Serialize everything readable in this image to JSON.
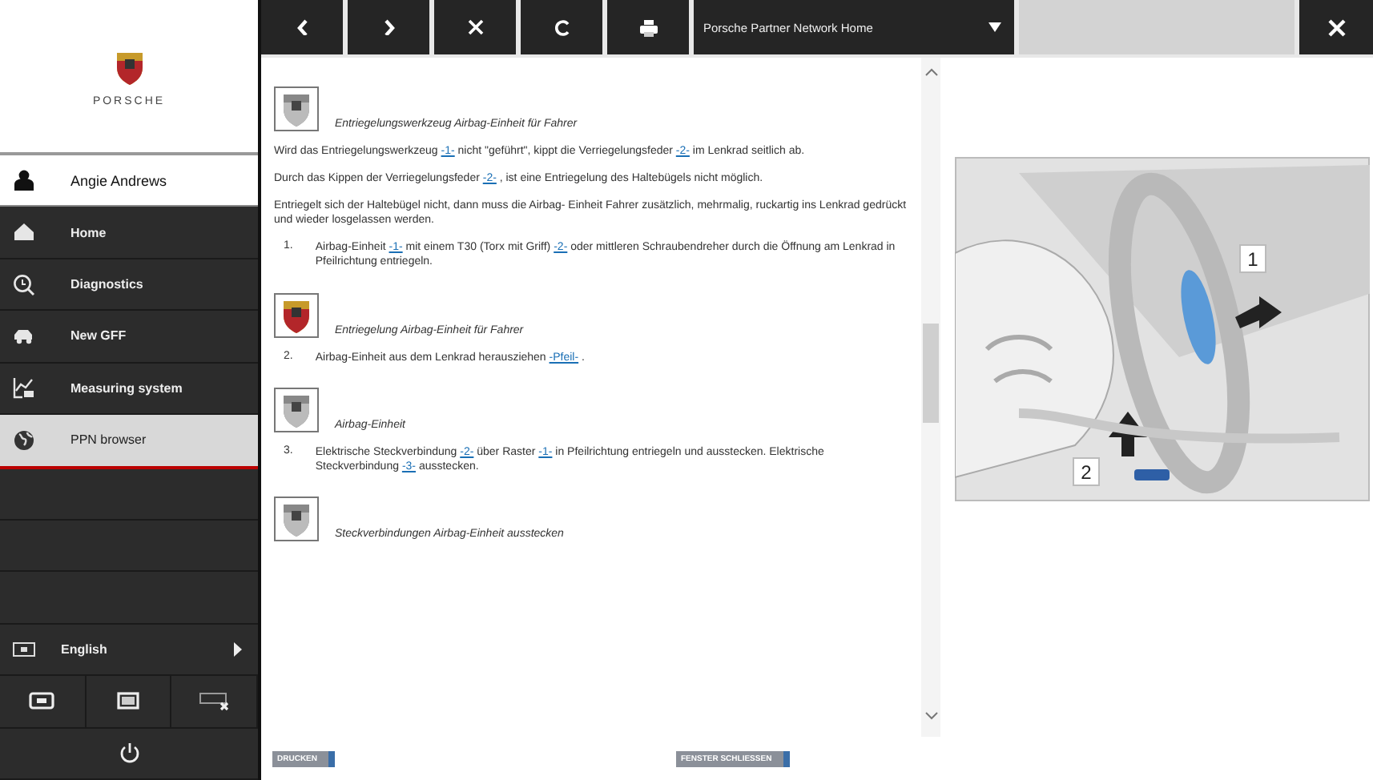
{
  "sidebar": {
    "brand": "PORSCHE",
    "user": "Angie Andrews",
    "items": [
      {
        "label": "Home",
        "selected": false
      },
      {
        "label": "Diagnostics",
        "selected": false
      },
      {
        "label": "New GFF",
        "selected": false
      },
      {
        "label": "Measuring system",
        "selected": false
      },
      {
        "label": "PPN browser",
        "selected": true
      }
    ],
    "language": "English"
  },
  "toolbar": {
    "address": "Porsche Partner Network Home"
  },
  "document": {
    "blocks": [
      {
        "kind": "figure",
        "colored": false,
        "caption": "Entriegelungswerkzeug Airbag-Einheit für Fahrer"
      },
      {
        "kind": "paragraph",
        "parts": [
          {
            "kind": "text",
            "text": "Wird das Entriegelungswerkzeug "
          },
          {
            "kind": "link",
            "text": "-1-"
          },
          {
            "kind": "text",
            "text": " nicht \"geführt\", kippt die Verriegelungsfeder "
          },
          {
            "kind": "link",
            "text": "-2-"
          },
          {
            "kind": "text",
            "text": " im Lenkrad seitlich ab."
          }
        ]
      },
      {
        "kind": "paragraph",
        "parts": [
          {
            "kind": "text",
            "text": "Durch das Kippen der Verriegelungsfeder "
          },
          {
            "kind": "link",
            "text": "-2-"
          },
          {
            "kind": "text",
            "text": " , ist eine Entriegelung des Haltebügels nicht möglich."
          }
        ]
      },
      {
        "kind": "paragraph",
        "parts": [
          {
            "kind": "text",
            "text": "Entriegelt sich der Haltebügel nicht, dann muss die Airbag- Einheit Fahrer zusätzlich, mehrmalig, ruckartig ins Lenkrad gedrückt und wieder losgelassen werden."
          }
        ]
      },
      {
        "kind": "step",
        "number": "1.",
        "parts": [
          {
            "kind": "text",
            "text": "Airbag-Einheit "
          },
          {
            "kind": "link",
            "text": "-1-"
          },
          {
            "kind": "text",
            "text": " mit einem T30 (Torx mit Griff) "
          },
          {
            "kind": "link",
            "text": "-2-"
          },
          {
            "kind": "text",
            "text": " oder mittleren Schraubendreher durch die Öffnung am Lenkrad in Pfeilrichtung entriegeln."
          }
        ]
      },
      {
        "kind": "figure",
        "colored": true,
        "caption": "Entriegelung Airbag-Einheit für Fahrer"
      },
      {
        "kind": "step",
        "number": "2.",
        "parts": [
          {
            "kind": "text",
            "text": "Airbag-Einheit aus dem Lenkrad herausziehen "
          },
          {
            "kind": "link",
            "text": "-Pfeil-"
          },
          {
            "kind": "text",
            "text": " ."
          }
        ]
      },
      {
        "kind": "figure",
        "colored": false,
        "caption": "Airbag-Einheit"
      },
      {
        "kind": "step",
        "number": "3.",
        "parts": [
          {
            "kind": "text",
            "text": "Elektrische Steckverbindung "
          },
          {
            "kind": "link",
            "text": "-2-"
          },
          {
            "kind": "text",
            "text": " über Raster "
          },
          {
            "kind": "link",
            "text": "-1-"
          },
          {
            "kind": "text",
            "text": " in Pfeilrichtung entriegeln und ausstecken. Elektrische Steckverbindung "
          },
          {
            "kind": "link",
            "text": "-3-"
          },
          {
            "kind": "text",
            "text": " ausstecken."
          }
        ]
      },
      {
        "kind": "figure",
        "colored": false,
        "caption": "Steckverbindungen Airbag-Einheit ausstecken"
      }
    ]
  },
  "buttons": [
    "DRUCKEN",
    "FENSTER SCHLIESSEN"
  ],
  "illustration": {
    "callouts": [
      "1",
      "2"
    ]
  }
}
